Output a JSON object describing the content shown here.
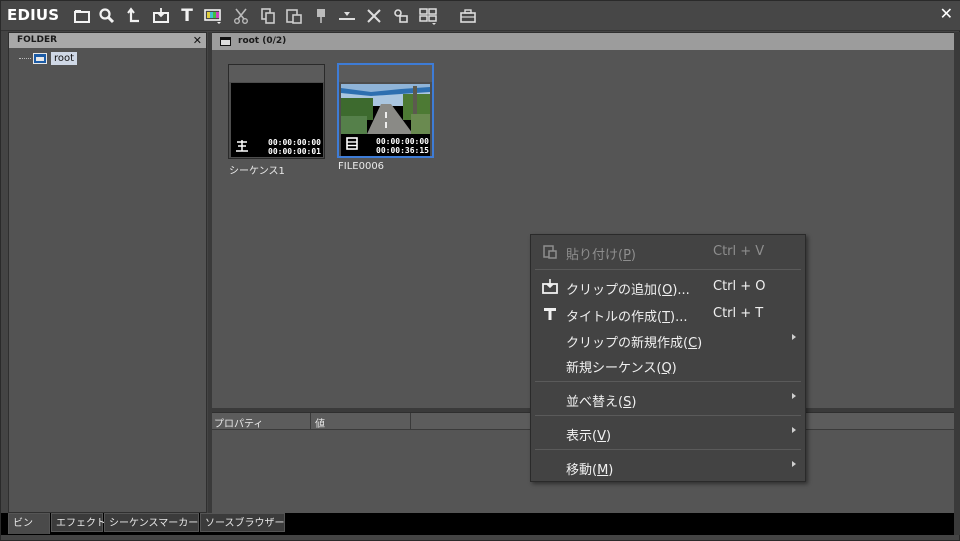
{
  "app": {
    "title": "EDIUS"
  },
  "toolbar": {
    "buttons": [
      {
        "name": "new-folder-icon"
      },
      {
        "name": "search-icon"
      },
      {
        "name": "up-icon"
      },
      {
        "name": "add-clip-icon"
      },
      {
        "name": "title-icon"
      },
      {
        "name": "color-bar-icon"
      },
      {
        "name": "cut-icon"
      },
      {
        "name": "copy-icon"
      },
      {
        "name": "paste-icon"
      },
      {
        "name": "add-to-player-icon"
      },
      {
        "name": "add-to-timeline-icon"
      },
      {
        "name": "delete-icon"
      },
      {
        "name": "properties-icon"
      },
      {
        "name": "view-icon"
      },
      {
        "name": "toolbox-icon"
      }
    ],
    "title_glyph": "T"
  },
  "folder_panel": {
    "header": "FOLDER",
    "close": "✕",
    "root_label": "root"
  },
  "bin": {
    "header": "root (0/2)",
    "clips": [
      {
        "name": "シーケンス1",
        "tc_in": "00:00:00:00",
        "tc_out": "00:00:00:01",
        "kind": "sequence",
        "selected": false
      },
      {
        "name": "FILE0006",
        "tc_in": "00:00:00:00",
        "tc_out": "00:00:36:15",
        "kind": "video",
        "selected": true
      }
    ]
  },
  "properties": {
    "col_property": "プロパティ",
    "col_value": "値"
  },
  "tabs": [
    {
      "label": "ビン",
      "active": true
    },
    {
      "label": "エフェクト",
      "active": false
    },
    {
      "label": "シーケンスマーカー",
      "active": false
    },
    {
      "label": "ソースブラウザー",
      "active": false
    }
  ],
  "context_menu": {
    "items": [
      {
        "label_pre": "貼り付け(",
        "key": "P",
        "label_post": ")",
        "shortcut": "Ctrl + V",
        "disabled": true,
        "icon": "paste-icon"
      },
      {
        "label_pre": "クリップの追加(",
        "key": "O",
        "label_post": ")...",
        "shortcut": "Ctrl + O",
        "disabled": false,
        "icon": "add-clip-icon"
      },
      {
        "label_pre": "タイトルの作成(",
        "key": "T",
        "label_post": ")...",
        "shortcut": "Ctrl + T",
        "disabled": false,
        "icon": "title-icon"
      },
      {
        "label_pre": "クリップの新規作成(",
        "key": "C",
        "label_post": ")",
        "shortcut": "",
        "disabled": false,
        "submenu": true
      },
      {
        "label_pre": "新規シーケンス(",
        "key": "Q",
        "label_post": ")",
        "shortcut": "",
        "disabled": false
      },
      {
        "label_pre": "並べ替え(",
        "key": "S",
        "label_post": ")",
        "shortcut": "",
        "disabled": false,
        "submenu": true
      },
      {
        "label_pre": "表示(",
        "key": "V",
        "label_post": ")",
        "shortcut": "",
        "disabled": false,
        "submenu": true
      },
      {
        "label_pre": "移動(",
        "key": "M",
        "label_post": ")",
        "shortcut": "",
        "disabled": false,
        "submenu": true
      }
    ]
  },
  "window": {
    "close": "✕"
  },
  "colors": {
    "selection": "#3e7cd6",
    "panel": "#555555",
    "toolbar": "#474747"
  }
}
